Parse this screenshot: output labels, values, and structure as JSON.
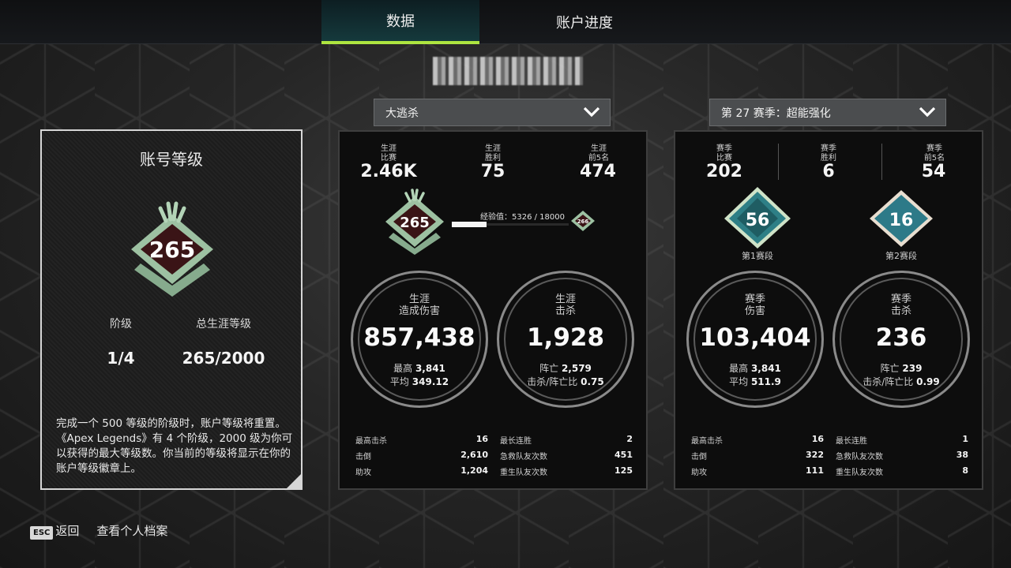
{
  "tabs": [
    {
      "label": "数据"
    },
    {
      "label": "账户进度"
    }
  ],
  "dropdowns": {
    "mode": "大逃杀",
    "season": "第 27 赛季：超能强化"
  },
  "account": {
    "title": "账号等级",
    "badge_level": "265",
    "prestige_label": "阶级",
    "prestige_value": "1/4",
    "total_label": "总生涯等级",
    "total_value": "265/2000",
    "description": "完成一个 500 等级的阶级时，账户等级将重置。《Apex Legends》有 4 个阶级，2000 级为你可以获得的最大等级数。你当前的等级将显示在你的账户等级徽章上。"
  },
  "career": {
    "top_stats": [
      {
        "label1": "生涯",
        "label2": "比赛",
        "value": "2.46K"
      },
      {
        "label1": "生涯",
        "label2": "胜利",
        "value": "75"
      },
      {
        "label1": "生涯",
        "label2": "前5名",
        "value": "474"
      }
    ],
    "badge_level": "265",
    "next_level": "266",
    "xp_text": "经验值：5326 / 18000",
    "xp_fraction": 0.296,
    "damage": {
      "label1": "生涯",
      "label2": "造成伤害",
      "value": "857,438",
      "sub1_label": "最高",
      "sub1_value": "3,841",
      "sub2_label": "平均",
      "sub2_value": "349.12"
    },
    "kills": {
      "label1": "生涯",
      "label2": "击杀",
      "value": "1,928",
      "sub1_label": "阵亡",
      "sub1_value": "2,579",
      "sub2_label": "击杀/阵亡比",
      "sub2_value": "0.75"
    },
    "rows_left": [
      {
        "label": "最高击杀",
        "value": "16"
      },
      {
        "label": "击倒",
        "value": "2,610"
      },
      {
        "label": "助攻",
        "value": "1,204"
      }
    ],
    "rows_right": [
      {
        "label": "最长连胜",
        "value": "2"
      },
      {
        "label": "急救队友次数",
        "value": "451"
      },
      {
        "label": "重生队友次数",
        "value": "125"
      }
    ]
  },
  "season": {
    "top_stats": [
      {
        "label1": "赛季",
        "label2": "比赛",
        "value": "202"
      },
      {
        "label1": "赛季",
        "label2": "胜利",
        "value": "6"
      },
      {
        "label1": "赛季",
        "label2": "前5名",
        "value": "54"
      }
    ],
    "split1": {
      "level": "56",
      "label": "第1赛段"
    },
    "split2": {
      "level": "16",
      "label": "第2赛段"
    },
    "damage": {
      "label1": "赛季",
      "label2": "伤害",
      "value": "103,404",
      "sub1_label": "最高",
      "sub1_value": "3,841",
      "sub2_label": "平均",
      "sub2_value": "511.9"
    },
    "kills": {
      "label1": "赛季",
      "label2": "击杀",
      "value": "236",
      "sub1_label": "阵亡",
      "sub1_value": "239",
      "sub2_label": "击杀/阵亡比",
      "sub2_value": "0.99"
    },
    "rows_left": [
      {
        "label": "最高击杀",
        "value": "16"
      },
      {
        "label": "击倒",
        "value": "322"
      },
      {
        "label": "助攻",
        "value": "111"
      }
    ],
    "rows_right": [
      {
        "label": "最长连胜",
        "value": "1"
      },
      {
        "label": "急救队友次数",
        "value": "38"
      },
      {
        "label": "重生队友次数",
        "value": "8"
      }
    ]
  },
  "footer": {
    "esc_key": "ESC",
    "back_label": "返回",
    "profile_label": "查看个人档案"
  },
  "colors": {
    "accent": "#aee540",
    "badge_green": "#8fb694",
    "badge_dark": "#3a1416",
    "season_teal": "#2e7f86"
  }
}
